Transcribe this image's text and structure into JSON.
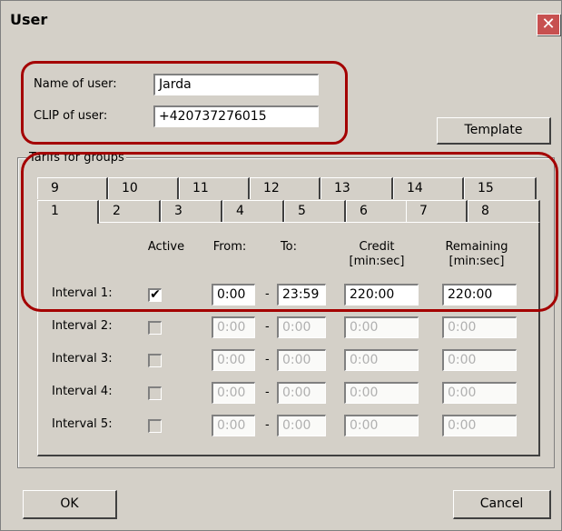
{
  "window": {
    "title": "User",
    "close_label": "✕"
  },
  "user": {
    "name_label": "Name of user:",
    "name_value": "Jarda",
    "clip_label": "CLIP of user:",
    "clip_value": "+420737276015"
  },
  "buttons": {
    "template": "Template",
    "ok": "OK",
    "cancel": "Cancel"
  },
  "group": {
    "label": "Tarifs for groups"
  },
  "tabs_top": [
    "9",
    "10",
    "11",
    "12",
    "13",
    "14",
    "15"
  ],
  "tabs_bottom": [
    "1",
    "2",
    "3",
    "4",
    "5",
    "6",
    "7",
    "8"
  ],
  "headers": {
    "active": "Active",
    "from": "From:",
    "to": "To:",
    "credit": "Credit\n[min:sec]",
    "remaining": "Remaining\n[min:sec]"
  },
  "intervals": [
    {
      "label": "Interval 1:",
      "active": true,
      "from": "0:00",
      "to": "23:59",
      "credit": "220:00",
      "remaining": "220:00",
      "enabled": true
    },
    {
      "label": "Interval 2:",
      "active": false,
      "from": "0:00",
      "to": "0:00",
      "credit": "0:00",
      "remaining": "0:00",
      "enabled": false
    },
    {
      "label": "Interval 3:",
      "active": false,
      "from": "0:00",
      "to": "0:00",
      "credit": "0:00",
      "remaining": "0:00",
      "enabled": false
    },
    {
      "label": "Interval 4:",
      "active": false,
      "from": "0:00",
      "to": "0:00",
      "credit": "0:00",
      "remaining": "0:00",
      "enabled": false
    },
    {
      "label": "Interval 5:",
      "active": false,
      "from": "0:00",
      "to": "0:00",
      "credit": "0:00",
      "remaining": "0:00",
      "enabled": false
    }
  ],
  "separator": "-",
  "check_mark": "✔",
  "colors": {
    "annotation": "#a40000",
    "close_button": "#c75050",
    "dialog": "#d4d0c8"
  }
}
